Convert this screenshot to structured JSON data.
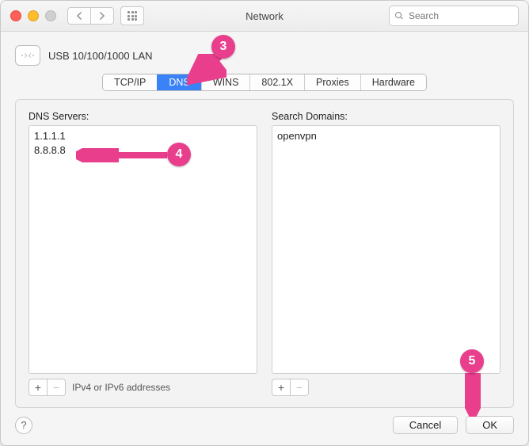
{
  "window": {
    "title": "Network"
  },
  "toolbar": {
    "search_placeholder": "Search"
  },
  "interface": {
    "name": "USB 10/100/1000 LAN"
  },
  "tabs": [
    {
      "id": "tcpip",
      "label": "TCP/IP"
    },
    {
      "id": "dns",
      "label": "DNS",
      "active": true
    },
    {
      "id": "wins",
      "label": "WINS"
    },
    {
      "id": "8021x",
      "label": "802.1X"
    },
    {
      "id": "proxies",
      "label": "Proxies"
    },
    {
      "id": "hardware",
      "label": "Hardware"
    }
  ],
  "dns": {
    "servers_label": "DNS Servers:",
    "servers": [
      "1.1.1.1",
      "8.8.8.8"
    ],
    "servers_hint": "IPv4 or IPv6 addresses",
    "domains_label": "Search Domains:",
    "domains": [
      "openvpn"
    ]
  },
  "buttons": {
    "cancel": "Cancel",
    "ok": "OK"
  },
  "annotations": {
    "a3": "3",
    "a4": "4",
    "a5": "5"
  }
}
